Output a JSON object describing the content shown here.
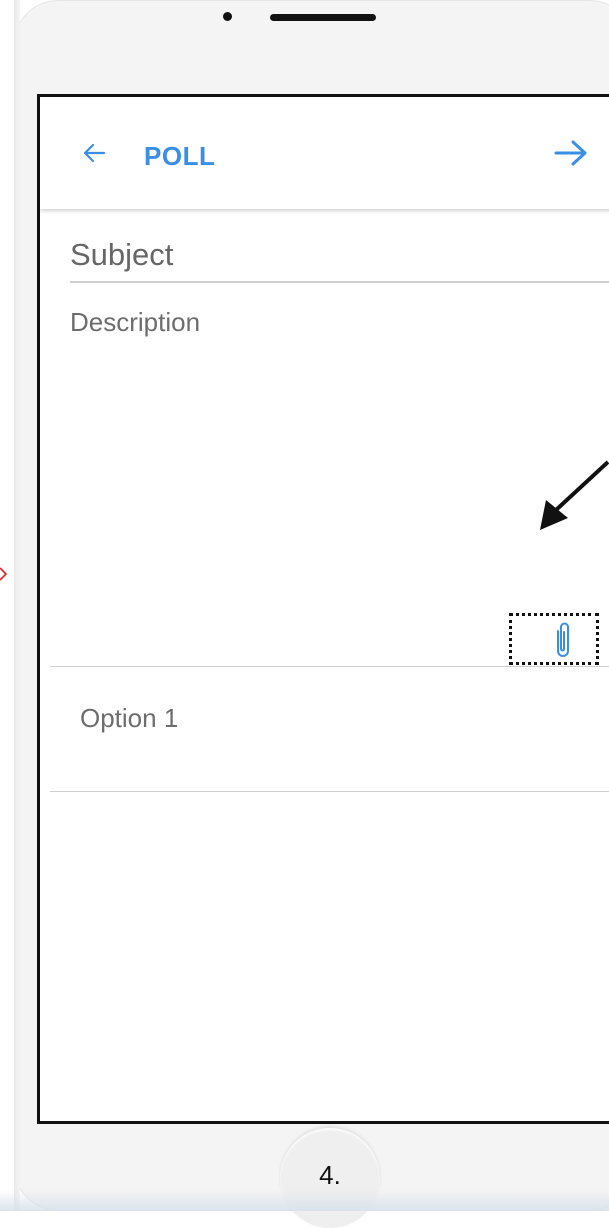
{
  "app_bar": {
    "title": "POLL",
    "back_icon": "arrow-left-icon",
    "next_icon": "arrow-right-icon",
    "accent_color": "#3a8ee6"
  },
  "form": {
    "subject_placeholder": "Subject",
    "description_placeholder": "Description",
    "option_1_placeholder": "Option 1",
    "attach_icon": "paperclip-icon"
  },
  "annotation": {
    "step_label": "4.",
    "highlight_target": "attachment"
  }
}
